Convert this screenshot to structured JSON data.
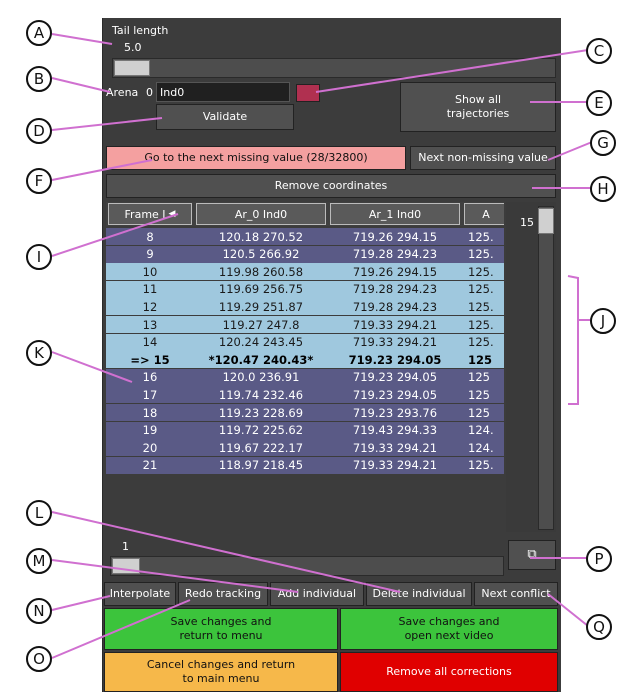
{
  "tail_length": {
    "label": "Tail length",
    "value": "5.0"
  },
  "arena": {
    "label": "Arena",
    "number": "0",
    "individual_value": "Ind0",
    "color": "#b03050"
  },
  "buttons": {
    "validate": "Validate",
    "show_all_line1": "Show all",
    "show_all_line2": "trajectories",
    "next_missing": "Go to the next missing value (28/32800)",
    "next_non_missing": "Next non-missing value",
    "remove_coordinates": "Remove coordinates",
    "interpolate": "Interpolate",
    "redo_tracking": "Redo tracking",
    "add_individual": "Add individual",
    "delete_individual": "Delete individual",
    "next_conflict": "Next conflict",
    "save_menu_line1": "Save changes and",
    "save_menu_line2": "return to menu",
    "save_next_line1": "Save changes and",
    "save_next_line2": "open next video",
    "cancel_line1": "Cancel changes and return",
    "cancel_line2": "to main menu",
    "remove_all": "Remove all corrections"
  },
  "table": {
    "headers": [
      "Frame I",
      "Ar_0 Ind0",
      "Ar_1 Ind0",
      "A"
    ],
    "rows": [
      [
        "8",
        "120.18 270.52",
        "719.26 294.15",
        "125."
      ],
      [
        "9",
        "120.5 266.92",
        "719.28 294.23",
        "125."
      ],
      [
        "10",
        "119.98 260.58",
        "719.26 294.15",
        "125."
      ],
      [
        "11",
        "119.69 256.75",
        "719.28 294.23",
        "125."
      ],
      [
        "12",
        "119.29 251.87",
        "719.28 294.23",
        "125."
      ],
      [
        "13",
        "119.27 247.8",
        "719.33 294.21",
        "125."
      ],
      [
        "14",
        "120.24 243.45",
        "719.33 294.21",
        "125."
      ],
      [
        "=> 15",
        "*120.47 240.43*",
        "719.23 294.05",
        "125"
      ],
      [
        "16",
        "120.0 236.91",
        "719.23 294.05",
        "125"
      ],
      [
        "17",
        "119.74 232.46",
        "719.23 294.05",
        "125"
      ],
      [
        "18",
        "119.23 228.69",
        "719.23 293.76",
        "125"
      ],
      [
        "19",
        "119.72 225.62",
        "719.43 294.33",
        "124."
      ],
      [
        "20",
        "119.67 222.17",
        "719.33 294.21",
        "124."
      ],
      [
        "21",
        "118.97 218.45",
        "719.33 294.21",
        "125."
      ]
    ],
    "highlight_rows": [
      2,
      3,
      4,
      5,
      6,
      7
    ],
    "current_row": 7
  },
  "vertical_slider_value": "15",
  "horizontal_slider_value": "1",
  "colors": {
    "pink": "#f4a0a0",
    "green": "#3cc43c",
    "orange": "#f6b84a",
    "red": "#e00000",
    "row_dark": "#5a5a86",
    "row_light": "#9fc8de",
    "callout_line": "#d070d0"
  },
  "callouts": [
    "A",
    "B",
    "C",
    "D",
    "E",
    "F",
    "G",
    "H",
    "I",
    "J",
    "K",
    "L",
    "M",
    "N",
    "O",
    "P",
    "Q"
  ]
}
